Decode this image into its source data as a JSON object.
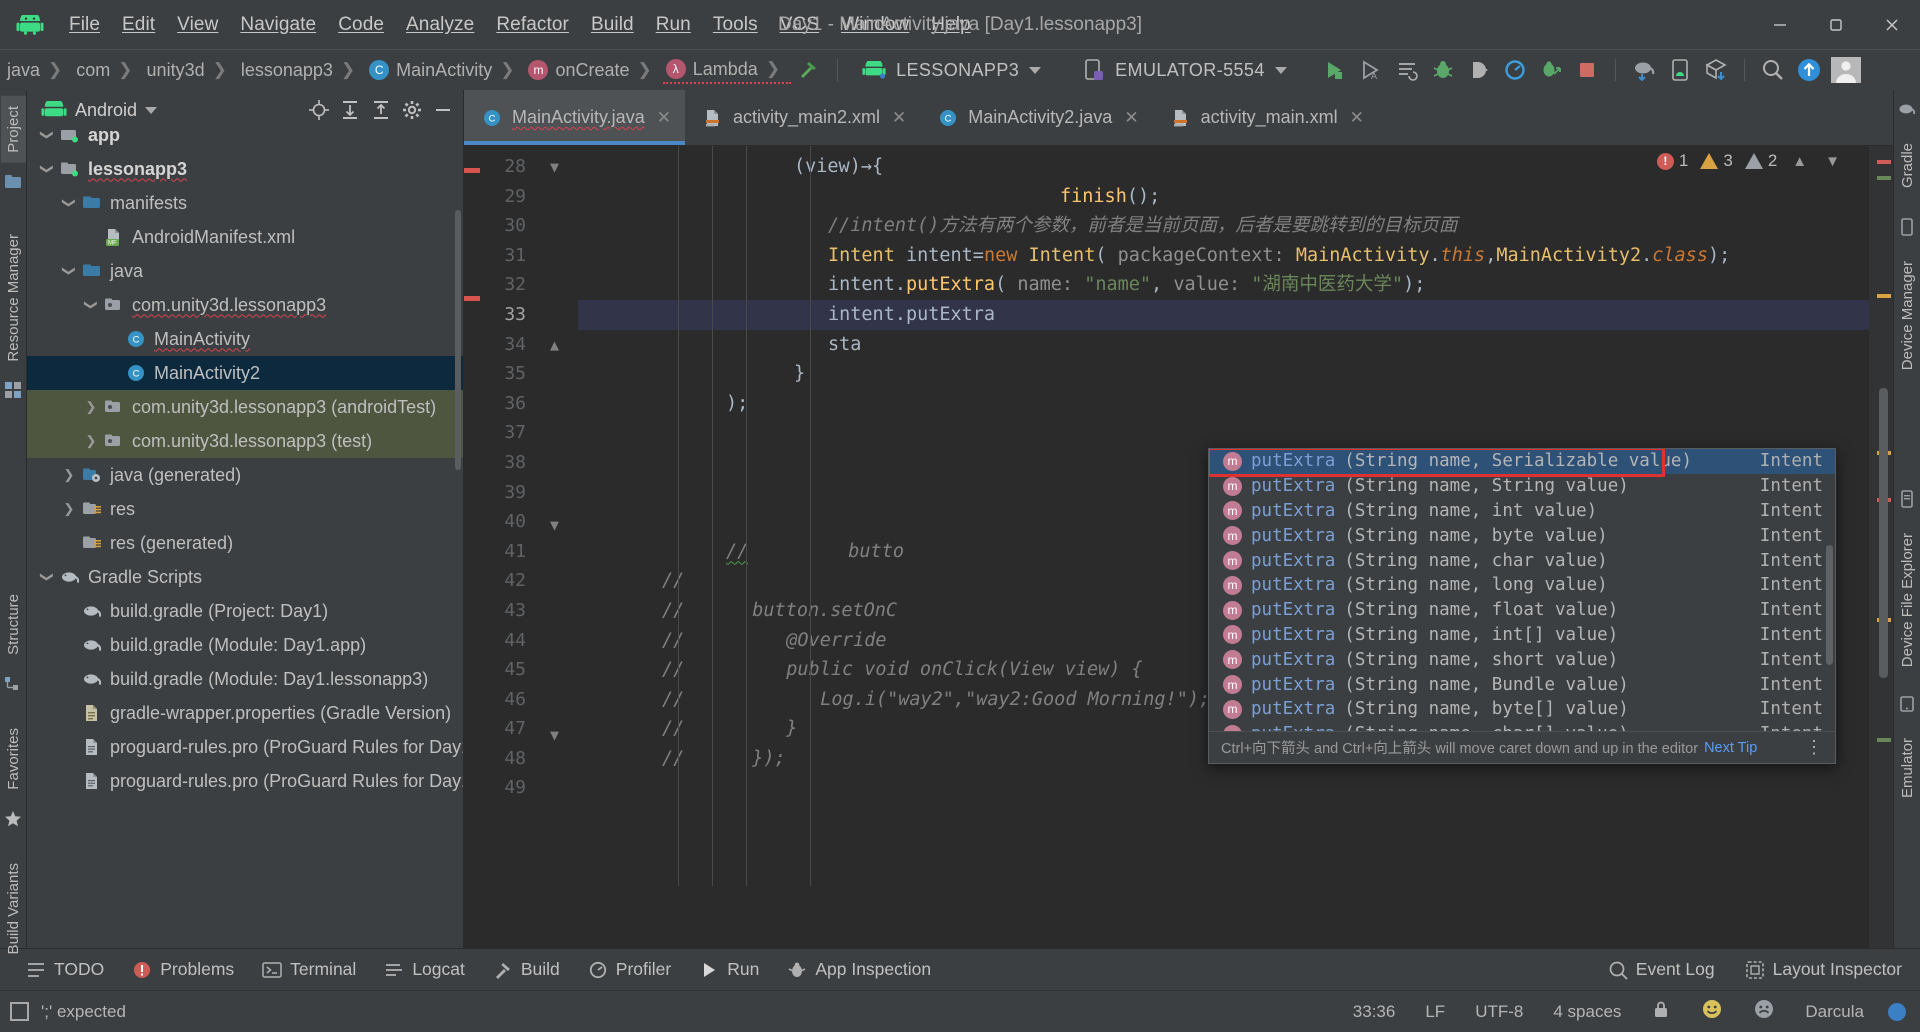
{
  "window": {
    "title": "Day1 - MainActivity.java [Day1.lessonapp3]",
    "controls": {
      "minimize": "–",
      "maximize": "❐",
      "close": "✕"
    }
  },
  "menubar": {
    "logo": "android-logo",
    "items": [
      "File",
      "Edit",
      "View",
      "Navigate",
      "Code",
      "Analyze",
      "Refactor",
      "Build",
      "Run",
      "Tools",
      "VCS",
      "Window",
      "Help"
    ]
  },
  "navbar": {
    "breadcrumbs": [
      {
        "label": "java",
        "badge": ""
      },
      {
        "label": "com",
        "badge": ""
      },
      {
        "label": "unity3d",
        "badge": ""
      },
      {
        "label": "lessonapp3",
        "badge": ""
      },
      {
        "label": "MainActivity",
        "badge": "C"
      },
      {
        "label": "onCreate",
        "badge": "m"
      },
      {
        "label": "Lambda",
        "badge": "λ"
      }
    ],
    "run_config": "LESSONAPP3",
    "device": "EMULATOR-5554",
    "icons": [
      "hammer-build-icon",
      "run-icon",
      "run-with-coverage-icon",
      "run-anything-icon",
      "debug-icon",
      "attach-debugger-icon",
      "profiler-icon",
      "apply-changes-icon",
      "stop-icon",
      "sync-gradle-icon",
      "avd-manager-icon",
      "sdk-manager-icon",
      "search-everywhere-icon",
      "update-icon",
      "avatar-icon"
    ]
  },
  "left_rail": {
    "tabs": [
      "Project",
      "Resource Manager",
      "Structure",
      "Favorites",
      "Build Variants"
    ]
  },
  "right_rail": {
    "tabs": [
      "Gradle",
      "Device Manager",
      "Device File Explorer",
      "Emulator"
    ]
  },
  "project_panel": {
    "title": "Android",
    "actions": [
      "locate-icon",
      "expand-all-icon",
      "collapse-all-icon",
      "settings-gear-icon",
      "hide-icon"
    ],
    "tree": [
      {
        "label": "app",
        "depth": 1,
        "arrow": "down",
        "icon": "module-folder-icon",
        "state": "normal",
        "bold": true,
        "cut": true
      },
      {
        "label": "lessonapp3",
        "depth": 1,
        "arrow": "down",
        "icon": "module-folder-icon",
        "state": "normal",
        "bold": true,
        "squiggle": true
      },
      {
        "label": "manifests",
        "depth": 2,
        "arrow": "down",
        "icon": "folder-blue-icon",
        "state": "normal"
      },
      {
        "label": "AndroidManifest.xml",
        "depth": 3,
        "arrow": "none",
        "icon": "manifest-file-icon",
        "state": "normal"
      },
      {
        "label": "java",
        "depth": 2,
        "arrow": "down",
        "icon": "folder-blue-icon",
        "state": "normal"
      },
      {
        "label": "com.unity3d.lessonapp3",
        "depth": 3,
        "arrow": "down",
        "icon": "package-icon",
        "state": "normal",
        "squiggle": true
      },
      {
        "label": "MainActivity",
        "depth": 4,
        "arrow": "none",
        "icon": "class-icon",
        "state": "normal",
        "squiggle": true
      },
      {
        "label": "MainActivity2",
        "depth": 4,
        "arrow": "none",
        "icon": "class-icon",
        "state": "selected"
      },
      {
        "label": "com.unity3d.lessonapp3 (androidTest)",
        "depth": 3,
        "arrow": "right",
        "icon": "package-icon",
        "state": "tinted"
      },
      {
        "label": "com.unity3d.lessonapp3 (test)",
        "depth": 3,
        "arrow": "right",
        "icon": "package-icon",
        "state": "tinted"
      },
      {
        "label": "java (generated)",
        "depth": 2,
        "arrow": "right",
        "icon": "folder-generated-icon",
        "state": "normal"
      },
      {
        "label": "res",
        "depth": 2,
        "arrow": "right",
        "icon": "folder-res-icon",
        "state": "normal"
      },
      {
        "label": "res (generated)",
        "depth": 2,
        "arrow": "none",
        "icon": "folder-res-icon",
        "state": "normal"
      },
      {
        "label": "Gradle Scripts",
        "depth": 1,
        "arrow": "down",
        "icon": "gradle-icon",
        "state": "normal"
      },
      {
        "label": "build.gradle (Project: Day1)",
        "depth": 2,
        "arrow": "none",
        "icon": "gradle-icon",
        "state": "normal"
      },
      {
        "label": "build.gradle (Module: Day1.app)",
        "depth": 2,
        "arrow": "none",
        "icon": "gradle-icon",
        "state": "normal"
      },
      {
        "label": "build.gradle (Module: Day1.lessonapp3)",
        "depth": 2,
        "arrow": "none",
        "icon": "gradle-icon",
        "state": "normal"
      },
      {
        "label": "gradle-wrapper.properties (Gradle Version)",
        "depth": 2,
        "arrow": "none",
        "icon": "properties-icon",
        "state": "normal"
      },
      {
        "label": "proguard-rules.pro (ProGuard Rules for Day1.app)",
        "depth": 2,
        "arrow": "none",
        "icon": "text-file-icon",
        "state": "normal"
      },
      {
        "label": "proguard-rules.pro (ProGuard Rules for Day1.lessonapp3)",
        "depth": 2,
        "arrow": "none",
        "icon": "text-file-icon",
        "state": "normal"
      }
    ]
  },
  "editor_tabs": [
    {
      "label": "MainActivity.java",
      "icon": "java-class-icon",
      "active": true,
      "squiggle": true
    },
    {
      "label": "activity_main2.xml",
      "icon": "xml-layout-icon",
      "active": false
    },
    {
      "label": "MainActivity2.java",
      "icon": "java-class-icon",
      "active": false
    },
    {
      "label": "activity_main.xml",
      "icon": "xml-layout-icon",
      "active": false
    }
  ],
  "inspections": {
    "errors": "1",
    "warnings": "3",
    "weak_warnings": "2"
  },
  "code": {
    "first_line": 28,
    "caret_line": 33,
    "lines": [
      {
        "n": 28,
        "html": "<span class=\"indentguide\" style=\"left:100px;top:0;height:29.6px\"></span><span class=\"plain\" style=\"padding-left:198px\">(view)→{</span>"
      },
      {
        "n": 29,
        "html": "<span class=\"plain\" style=\"padding-left:232px\"></span><span class=\"mth\" style=\"margin-left:232px\">finish</span><span class=\"plain\">();</span>"
      },
      {
        "n": 30,
        "html": "<span class=\"cmt\" style=\"margin-left:232px\">//intent()方法有两个参数，前者是当前页面，后者是要跳转到的目标页面</span>"
      },
      {
        "n": 31,
        "html": "<span class=\"typ\" style=\"margin-left:232px\">Intent</span><span class=\"plain\"> intent=</span><span class=\"kw\">new</span><span class=\"plain\"> </span><span class=\"typ\">Intent</span><span class=\"plain\">( </span><span class=\"hint\">packageContext:</span><span class=\"plain\"> </span><span class=\"typ\">MainActivity</span><span class=\"plain\">.</span><span class=\"kw-i\">this</span><span class=\"plain\">,</span><span class=\"typ\">MainActivity2</span><span class=\"plain\">.</span><span class=\"kw-i\">class</span><span class=\"plain\">);</span>"
      },
      {
        "n": 32,
        "html": "<span class=\"plain\" style=\"margin-left:232px\">intent.</span><span class=\"mth\">putExtra</span><span class=\"plain\">( </span><span class=\"hint\">name:</span><span class=\"plain\"> </span><span class=\"str\">\"name\"</span><span class=\"plain\">, </span><span class=\"hint\">value:</span><span class=\"plain\"> </span><span class=\"str\">\"湖南中医药大学\"</span><span class=\"plain\">);</span>"
      },
      {
        "n": 33,
        "html": "<span class=\"plain\" style=\"margin-left:232px\">intent.putExtra</span>"
      },
      {
        "n": 34,
        "html": "<span class=\"plain\" style=\"margin-left:232px\">sta</span>"
      },
      {
        "n": 35,
        "html": "<span class=\"plain\" style=\"margin-left:198px\">}</span>"
      },
      {
        "n": 36,
        "html": "<span class=\"plain\" style=\"margin-left:130px\">);</span>"
      },
      {
        "n": 37,
        "html": ""
      },
      {
        "n": 38,
        "html": ""
      },
      {
        "n": 39,
        "html": ""
      },
      {
        "n": 40,
        "html": ""
      },
      {
        "n": 41,
        "html": "<span class=\"cmt squigl\" style=\"margin-left:130px\">//</span><span class=\"cmt\" style=\"margin-left:100px\">butto</span>"
      },
      {
        "n": 42,
        "html": "<span class=\"cmt\" style=\"margin-left:66px\">//</span>"
      },
      {
        "n": 43,
        "html": "<span class=\"cmt\" style=\"margin-left:66px\">//</span><span class=\"cmt\" style=\"margin-left:68px\">button.setOnC</span>"
      },
      {
        "n": 44,
        "html": "<span class=\"cmt\" style=\"margin-left:66px\">//</span><span class=\"cmt\" style=\"margin-left:102px\">@Override</span>"
      },
      {
        "n": 45,
        "html": "<span class=\"cmt\" style=\"margin-left:66px\">//</span><span class=\"cmt\" style=\"margin-left:102px\">public void onClick(View view) {</span>"
      },
      {
        "n": 46,
        "html": "<span class=\"cmt\" style=\"margin-left:66px\">//</span><span class=\"cmt\" style=\"margin-left:136px\">Log.i(\"way2\",\"way2:Good Morning!\");</span>"
      },
      {
        "n": 47,
        "html": "<span class=\"cmt\" style=\"margin-left:66px\">//</span><span class=\"cmt\" style=\"margin-left:102px\">}</span>"
      },
      {
        "n": 48,
        "html": "<span class=\"cmt\" style=\"margin-left:66px\">//</span><span class=\"cmt\" style=\"margin-left:68px\">});</span>"
      },
      {
        "n": 49,
        "html": ""
      }
    ]
  },
  "autocomplete": {
    "items": [
      {
        "name": "putExtra",
        "sig": "(String name, Serializable value)",
        "type": "Intent",
        "selected": true
      },
      {
        "name": "putExtra",
        "sig": "(String name, String value)",
        "type": "Intent"
      },
      {
        "name": "putExtra",
        "sig": "(String name, int value)",
        "type": "Intent"
      },
      {
        "name": "putExtra",
        "sig": "(String name, byte value)",
        "type": "Intent"
      },
      {
        "name": "putExtra",
        "sig": "(String name, char value)",
        "type": "Intent"
      },
      {
        "name": "putExtra",
        "sig": "(String name, long value)",
        "type": "Intent"
      },
      {
        "name": "putExtra",
        "sig": "(String name, float value)",
        "type": "Intent"
      },
      {
        "name": "putExtra",
        "sig": "(String name, int[] value)",
        "type": "Intent"
      },
      {
        "name": "putExtra",
        "sig": "(String name, short value)",
        "type": "Intent"
      },
      {
        "name": "putExtra",
        "sig": "(String name, Bundle value)",
        "type": "Intent"
      },
      {
        "name": "putExtra",
        "sig": "(String name, byte[] value)",
        "type": "Intent"
      },
      {
        "name": "putExtra",
        "sig": "(String name, char[] value)",
        "type": "Intent"
      }
    ],
    "footer_text": "Ctrl+向下箭头 and Ctrl+向上箭头 will move caret down and up in the editor",
    "footer_link": "Next Tip",
    "footer_more": "⋮"
  },
  "bottombar": {
    "left": [
      {
        "label": "TODO",
        "icon": "todo-icon"
      },
      {
        "label": "Problems",
        "icon": "problems-icon"
      },
      {
        "label": "Terminal",
        "icon": "terminal-icon"
      },
      {
        "label": "Logcat",
        "icon": "logcat-icon"
      },
      {
        "label": "Build",
        "icon": "build-hammer-icon"
      },
      {
        "label": "Profiler",
        "icon": "profiler-icon"
      },
      {
        "label": "Run",
        "icon": "run-play-icon"
      },
      {
        "label": "App Inspection",
        "icon": "app-inspection-icon"
      }
    ],
    "right": [
      {
        "label": "Event Log",
        "icon": "event-log-icon"
      },
      {
        "label": "Layout Inspector",
        "icon": "layout-inspector-icon"
      }
    ]
  },
  "statusbar": {
    "message": "';' expected",
    "caret": "33:36",
    "line_ending": "LF",
    "encoding": "UTF-8",
    "indent": "4 spaces",
    "theme": "Darcula",
    "icons": [
      "lock-icon",
      "smiley-happy-icon",
      "smiley-sad-icon"
    ]
  },
  "colors": {
    "accent_blue": "#4a88c7",
    "selection_blue": "#2d5177",
    "tree_selection": "#0d293e",
    "tree_tint": "#4e5640",
    "error_red": "#cf5b56",
    "warning_amber": "#d9a343",
    "highlight_box": "#e03030",
    "editor_bg": "#2b2b2b",
    "chrome_bg": "#3c3f41"
  }
}
